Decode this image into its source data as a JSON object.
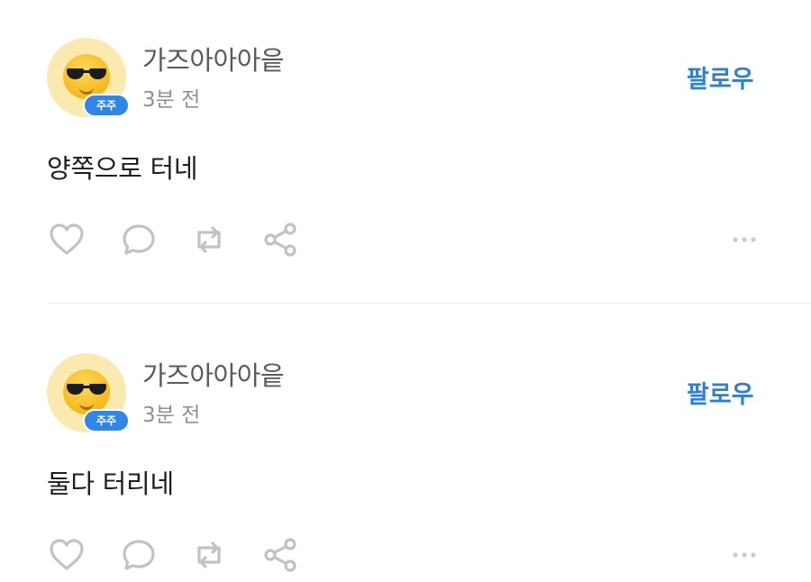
{
  "posts": [
    {
      "author": "가즈아아아읕",
      "badge": "주주",
      "time": "3분 전",
      "follow_label": "팔로우",
      "content": "양쪽으로 터네",
      "actions": [
        "heart-icon",
        "comment-icon",
        "repost-icon",
        "share-icon",
        "more-icon"
      ]
    },
    {
      "author": "가즈아아아읕",
      "badge": "주주",
      "time": "3분 전",
      "follow_label": "팔로우",
      "content": "둘다 터리네",
      "actions": [
        "heart-icon",
        "comment-icon",
        "repost-icon",
        "share-icon",
        "more-icon"
      ]
    }
  ],
  "colors": {
    "accent": "#2e7fd8",
    "badge": "#2f86e6",
    "icon": "#bfc3c8",
    "avatar_bg": "#fbeab0"
  }
}
